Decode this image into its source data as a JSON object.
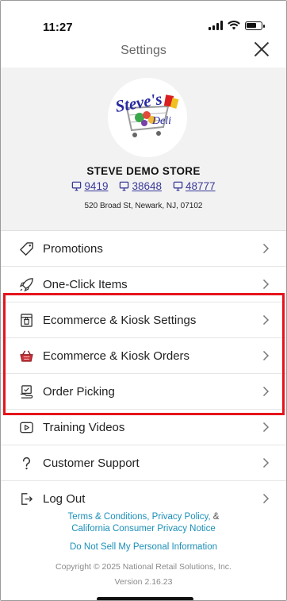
{
  "status_bar": {
    "time": "11:27"
  },
  "header": {
    "title": "Settings"
  },
  "store": {
    "logo_alt": "Steve's Deli logo",
    "logo_text_top": "Steve's",
    "logo_text_bottom": "Deli",
    "name": "STEVE DEMO STORE",
    "ids": [
      "9419",
      "38648",
      "48777"
    ],
    "address": "520 Broad St,  Newark,  NJ, 07102"
  },
  "menu": [
    {
      "label": "Promotions",
      "icon": "tag-icon"
    },
    {
      "label": "One-Click Items",
      "icon": "rocket-icon"
    },
    {
      "label": "Ecommerce & Kiosk Settings",
      "icon": "kiosk-icon"
    },
    {
      "label": "Ecommerce & Kiosk Orders",
      "icon": "basket-icon"
    },
    {
      "label": "Order Picking",
      "icon": "picking-icon"
    },
    {
      "label": "Training Videos",
      "icon": "play-icon"
    },
    {
      "label": "Customer Support",
      "icon": "question-icon"
    },
    {
      "label": "Log Out",
      "icon": "logout-icon"
    }
  ],
  "footer": {
    "terms": "Terms & Conditions,",
    "privacy": "Privacy Policy,",
    "amp": "&",
    "california": "California Consumer Privacy Notice",
    "dns": "Do Not Sell My Personal Information",
    "copyright": "Copyright © 2025 National Retail Solutions, Inc.",
    "version": "Version 2.16.23"
  },
  "colors": {
    "link": "#1b8fb8",
    "store_id": "#3a3a9a",
    "highlight": "#e5141b",
    "panel_bg": "#f2f2f2"
  }
}
